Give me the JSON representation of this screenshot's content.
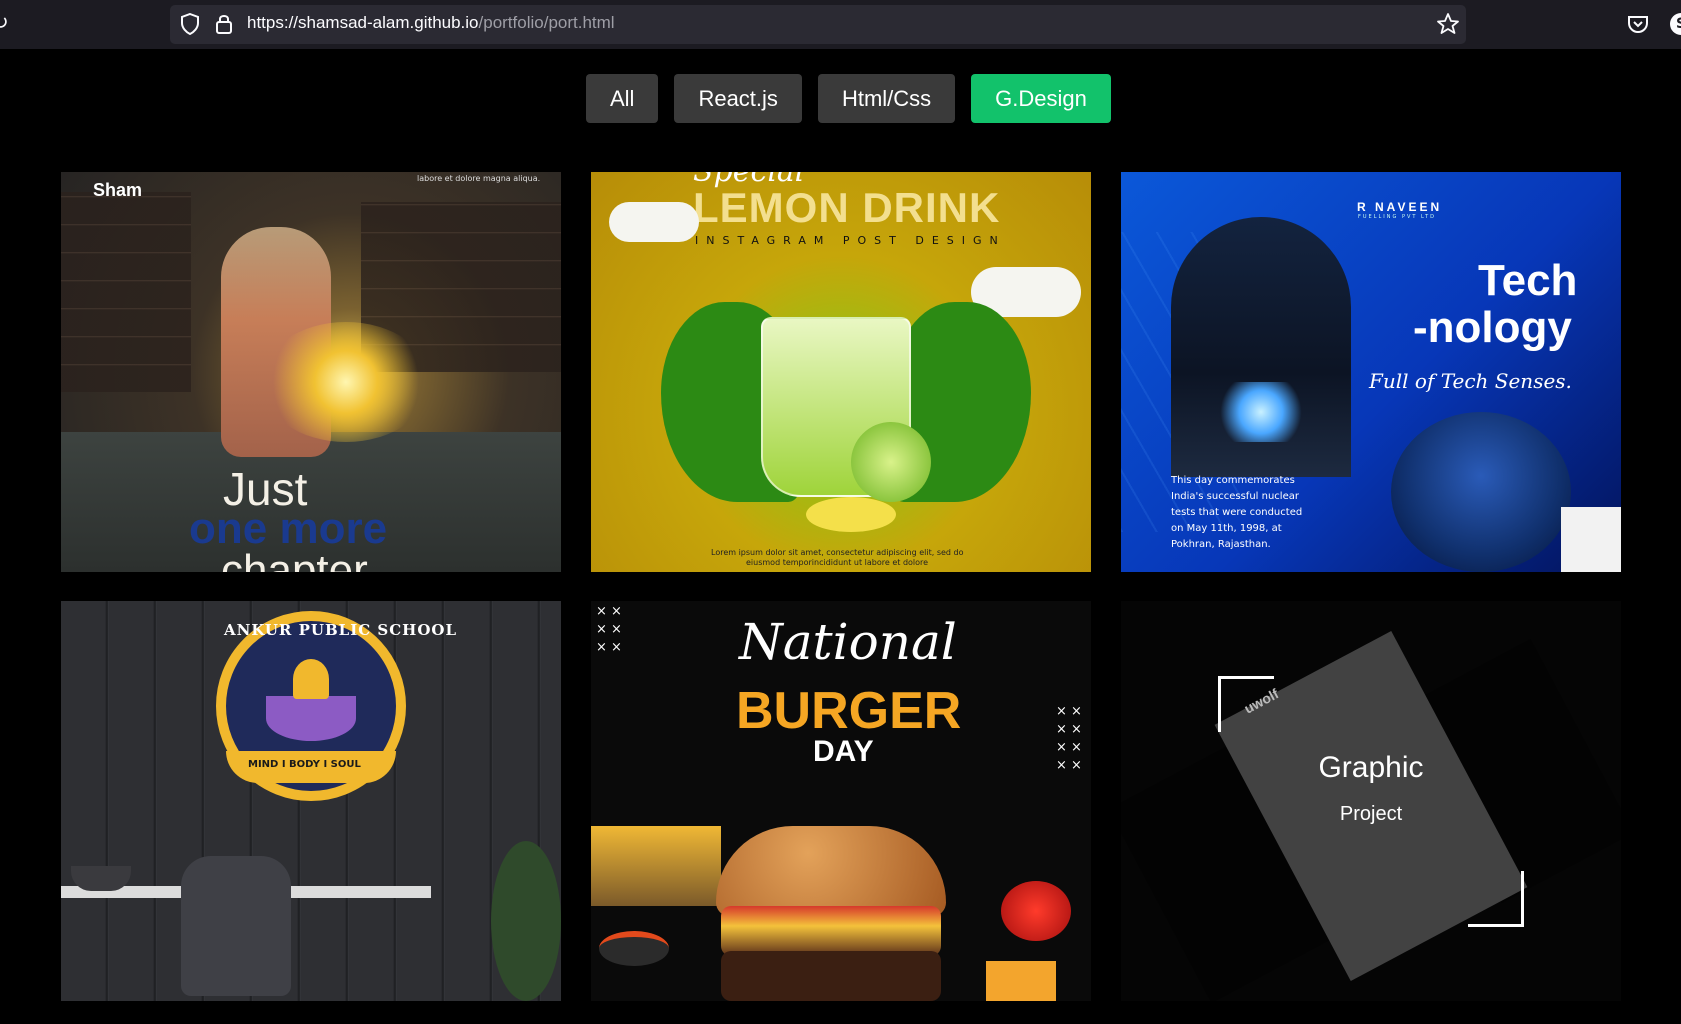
{
  "browser": {
    "url_host": "https://shamsad-alam.github.io",
    "url_path": "/portfolio/port.html",
    "account_initial": "S"
  },
  "filters": [
    {
      "label": "All",
      "active": false
    },
    {
      "label": "React.js",
      "active": false
    },
    {
      "label": "Html/Css",
      "active": false
    },
    {
      "label": "G.Design",
      "active": true
    }
  ],
  "colors": {
    "accent": "#12c26b",
    "button": "#3a3a3a",
    "page_bg": "#000000"
  },
  "cards": {
    "reading": {
      "logo": "Sham",
      "small_text": "labore et dolore magna aliqua.",
      "line1": "Just",
      "line2": "one more",
      "line3": "chapter"
    },
    "lemon": {
      "top": "Special",
      "title": "LEMON DRINK",
      "subtitle": "INSTAGRAM POST DESIGN",
      "caption1": "Lorem ipsum dolor sit amet, consectetur adipiscing elit, sed do",
      "caption2": "eiusmod temporincididunt ut labore et dolore"
    },
    "tech": {
      "brand": "R NAVEEN",
      "brand_sub": "FUELLING PVT LTD",
      "title1": "Tech",
      "title2": "-nology",
      "tagline": "Full of Tech Senses.",
      "body1": "This day commemorates",
      "body2": "India's successful nuclear",
      "body3": "tests that were conducted",
      "body4": "on May 11th, 1998, at",
      "body5": "Pokhran, Rajasthan."
    },
    "school": {
      "arc_text": "ANKUR PUBLIC SCHOOL",
      "ribbon": "MIND I BODY I SOUL"
    },
    "burger": {
      "script": "National",
      "title": "BURGER",
      "day": "DAY"
    },
    "graphic": {
      "title": "Graphic",
      "subtitle": "Project",
      "brand": "uwolf"
    }
  }
}
